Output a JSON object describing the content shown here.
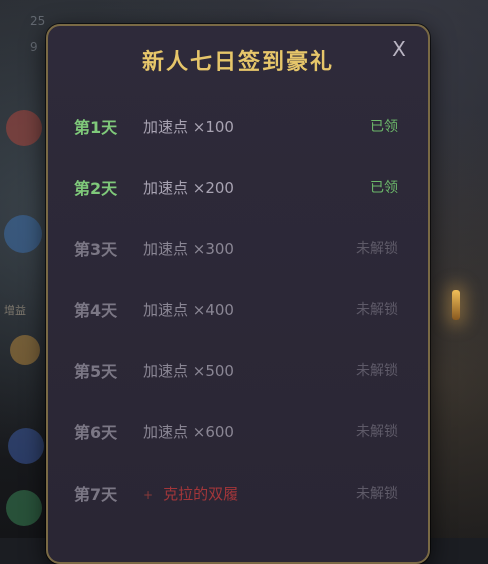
{
  "background": {
    "corner_numbers": [
      "25",
      "9"
    ],
    "side_label": "增益"
  },
  "dialog": {
    "title": "新人七日签到豪礼",
    "close_label": "X",
    "days": [
      {
        "day": "第1天",
        "reward": "加速点 ×100",
        "status": "已领",
        "state": "claimed"
      },
      {
        "day": "第2天",
        "reward": "加速点 ×200",
        "status": "已领",
        "state": "claimed"
      },
      {
        "day": "第3天",
        "reward": "加速点 ×300",
        "status": "未解锁",
        "state": "locked"
      },
      {
        "day": "第4天",
        "reward": "加速点 ×400",
        "status": "未解锁",
        "state": "locked"
      },
      {
        "day": "第5天",
        "reward": "加速点 ×500",
        "status": "未解锁",
        "state": "locked"
      },
      {
        "day": "第6天",
        "reward": "加速点 ×600",
        "status": "未解锁",
        "state": "locked"
      },
      {
        "day": "第7天",
        "reward_prefix": "+",
        "reward": "克拉的双履",
        "status": "未解锁",
        "state": "locked"
      }
    ]
  },
  "colors": {
    "title": "#e6c66a",
    "claimed": "#7fc97a",
    "locked": "#7b7785",
    "special_reward": "#a2363a",
    "dialog_border": "#7a6a45"
  }
}
